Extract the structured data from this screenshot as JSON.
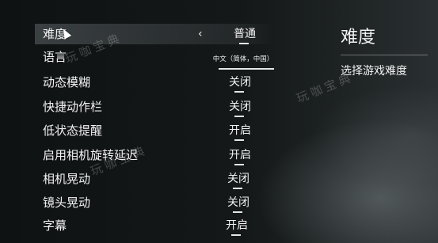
{
  "settings": [
    {
      "label": "难度",
      "value": "普通"
    },
    {
      "label": "语言",
      "value": "中文（简体，中国）"
    },
    {
      "label": "动态模糊",
      "value": "关闭"
    },
    {
      "label": "快捷动作栏",
      "value": "关闭"
    },
    {
      "label": "低状态提醒",
      "value": "开启"
    },
    {
      "label": "启用相机旋转延迟",
      "value": "开启"
    },
    {
      "label": "相机晃动",
      "value": "关闭"
    },
    {
      "label": "镜头晃动",
      "value": "关闭"
    },
    {
      "label": "字幕",
      "value": "开启"
    }
  ],
  "selected_index": 0,
  "prev_arrow": "‹",
  "panel": {
    "title": "难度",
    "description": "选择游戏难度"
  },
  "watermark": "玩咖宝典",
  "icons": {
    "cursor": "mouse-pointer-icon",
    "prev": "chevron-left-icon"
  },
  "colors": {
    "background": "#121516",
    "text": "#f2f2f2",
    "highlight": "#aab4b9"
  }
}
